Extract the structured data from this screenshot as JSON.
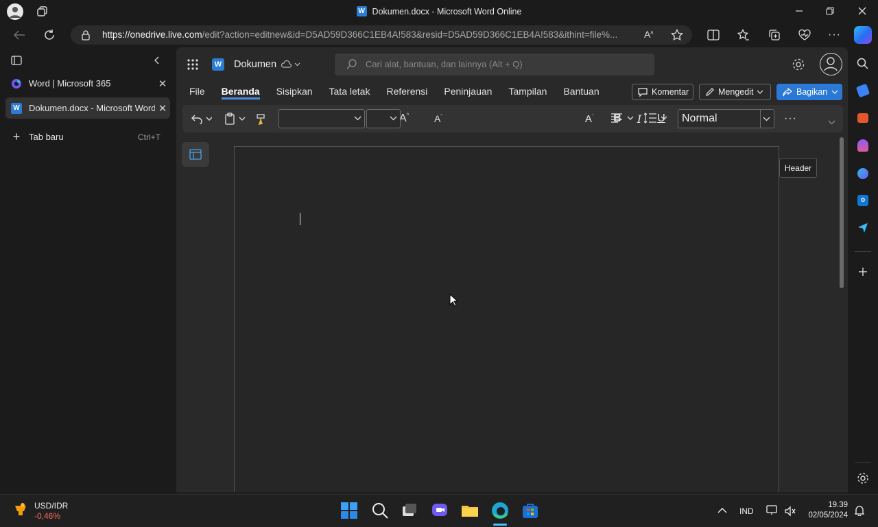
{
  "window": {
    "title": "Dokumen.docx - Microsoft Word Online",
    "word_logo_letter": "W"
  },
  "browser": {
    "url_domain": "https://onedrive.live.com",
    "url_rest": "/edit?action=editnew&id=D5AD59D366C1EB4A!583&resid=D5AD59D366C1EB4A!583&ithint=file%...",
    "tabs": [
      {
        "label": "Word | Microsoft 365",
        "close": "✕"
      },
      {
        "label": "Dokumen.docx - Microsoft Word",
        "close": "✕"
      }
    ],
    "new_tab": {
      "label": "Tab baru",
      "shortcut": "Ctrl+T"
    }
  },
  "word": {
    "doc_name": "Dokumen",
    "search_placeholder": "Cari alat, bantuan, dan lainnya (Alt + Q)",
    "menu": [
      "File",
      "Beranda",
      "Sisipkan",
      "Tata letak",
      "Referensi",
      "Peninjauan",
      "Tampilan",
      "Bantuan"
    ],
    "active_menu": "Beranda",
    "comment_button": "Komentar",
    "edit_button": "Mengedit",
    "share_button": "Bagikan",
    "font_name": "",
    "font_size": "",
    "style": "Normal",
    "tooltip": "Header"
  },
  "taskbar": {
    "ticker_name": "USD/IDR",
    "ticker_change": "-0,46%",
    "lang": "IND",
    "time": "19.39",
    "date": "02/05/2024"
  },
  "colors": {
    "accent": "#1a73e8",
    "share_bg": "#2b78d6",
    "ticker_negative": "#ff6b5b"
  }
}
